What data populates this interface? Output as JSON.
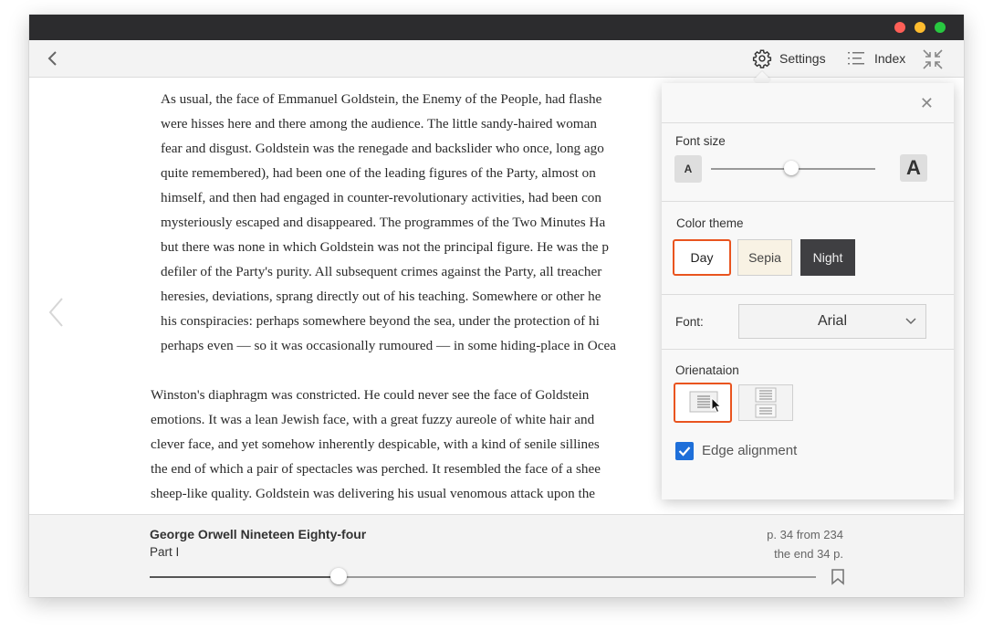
{
  "toolbar": {
    "settings_label": "Settings",
    "index_label": "Index"
  },
  "reader": {
    "paragraphs": [
      [
        "As usual, the face of Emmanuel Goldstein, the Enemy of the People, had flashe",
        "were hisses here and there among the audience. The little sandy-haired woman",
        "fear and disgust. Goldstein was the renegade and backslider who once, long ago",
        "quite remembered), had been one of the leading figures of the Party, almost on",
        "himself, and then had engaged in counter-revolutionary activities, had been con",
        "mysteriously escaped and disappeared. The programmes of the Two Minutes Ha",
        "but there was none in which Goldstein was not the principal figure. He was the p",
        "defiler of the Party's purity. All subsequent crimes against the Party, all treacher",
        "heresies, deviations, sprang directly out of his teaching. Somewhere or other he",
        "his conspiracies: perhaps somewhere beyond the sea, under the protection of hi",
        "perhaps even — so it was occasionally rumoured — in some hiding-place in Ocea"
      ],
      [
        "Winston's diaphragm was constricted. He could never see the face of Goldstein",
        "emotions. It was a lean Jewish face, with a great fuzzy aureole of white hair and",
        "clever face, and yet somehow inherently despicable, with a kind of senile sillines",
        "the end of which a pair of spectacles was perched. It resembled the face of a shee",
        "sheep-like quality. Goldstein was delivering his usual venomous attack upon the"
      ]
    ]
  },
  "settings": {
    "font_size_label": "Font size",
    "font_size_small_glyph": "A",
    "font_size_large_glyph": "A",
    "font_size_level": 0.49,
    "color_theme_label": "Color theme",
    "themes": [
      "Day",
      "Sepia",
      "Night"
    ],
    "selected_theme": "Day",
    "font_label": "Font:",
    "font_value": "Arial",
    "orientation_label": "Orienataion",
    "edge_alignment_label": "Edge alignment",
    "edge_alignment_checked": true,
    "accent_color": "#e9541f",
    "checkbox_color": "#1e6fd9"
  },
  "footer": {
    "book_title": "George Orwell Nineteen Eighty-four",
    "part": "Part I",
    "page_info": "p. 34 from 234",
    "page_end": "the end 34 p.",
    "progress": 0.283
  }
}
